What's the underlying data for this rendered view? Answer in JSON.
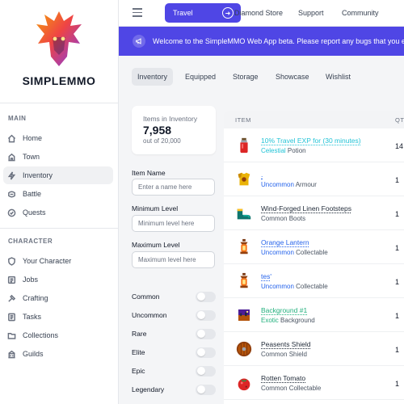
{
  "brand": {
    "name": "SIMPLEMMO"
  },
  "sidebar": {
    "main_section": "MAIN",
    "character_section": "CHARACTER",
    "main_items": [
      {
        "label": "Home",
        "icon": "home-icon"
      },
      {
        "label": "Town",
        "icon": "town-icon"
      },
      {
        "label": "Inventory",
        "icon": "lightning-icon",
        "active": true
      },
      {
        "label": "Battle",
        "icon": "battle-icon"
      },
      {
        "label": "Quests",
        "icon": "quest-icon"
      }
    ],
    "character_items": [
      {
        "label": "Your Character",
        "icon": "shield-icon"
      },
      {
        "label": "Jobs",
        "icon": "jobs-icon"
      },
      {
        "label": "Crafting",
        "icon": "crafting-icon"
      },
      {
        "label": "Tasks",
        "icon": "tasks-icon"
      },
      {
        "label": "Collections",
        "icon": "folder-icon"
      },
      {
        "label": "Guilds",
        "icon": "guilds-icon"
      }
    ]
  },
  "topbar": {
    "travel_label": "Travel",
    "links": [
      "Diamond Store",
      "Support",
      "Community"
    ]
  },
  "banner": {
    "text": "Welcome to the SimpleMMO Web App beta. Please report any bugs that you exp"
  },
  "tabs": [
    "Inventory",
    "Equipped",
    "Storage",
    "Showcase",
    "Wishlist"
  ],
  "stats": {
    "label": "Items in Inventory",
    "value": "7,958",
    "sub": "out of 20,000"
  },
  "filters": {
    "item_name_label": "Item Name",
    "item_name_placeholder": "Enter a name here",
    "min_level_label": "Minimum Level",
    "min_level_placeholder": "Minimum level here",
    "max_level_label": "Maximum Level",
    "max_level_placeholder": "Maximum level here",
    "rarities": [
      "Common",
      "Uncommon",
      "Rare",
      "Elite",
      "Epic",
      "Legendary"
    ]
  },
  "table": {
    "col_item": "ITEM",
    "col_qty": "QT",
    "rows": [
      {
        "name": "10% Travel EXP for (30 minutes)",
        "rarity": "Celestial",
        "type": "Potion",
        "qty": "14",
        "color_class": "c-celestial",
        "icon": "potion-icon"
      },
      {
        "name": ".",
        "rarity": "Uncommon",
        "type": "Armour",
        "qty": "1",
        "color_class": "c-uncommon",
        "icon": "armour-icon"
      },
      {
        "name": "Wind-Forged Linen Footsteps",
        "rarity": "Common",
        "type": "Boots",
        "qty": "1",
        "color_class": "c-common",
        "icon": "boots-icon"
      },
      {
        "name": "Orange Lantern",
        "rarity": "Uncommon",
        "type": "Collectable",
        "qty": "1",
        "color_class": "c-uncommon",
        "icon": "lantern-icon"
      },
      {
        "name": "tes'",
        "rarity": "Uncommon",
        "type": "Collectable",
        "qty": "1",
        "color_class": "c-uncommon",
        "icon": "lantern-icon"
      },
      {
        "name": "Background #1",
        "rarity": "Exotic",
        "type": "Background",
        "qty": "1",
        "color_class": "c-exotic",
        "icon": "background-icon"
      },
      {
        "name": "Peasents Shield",
        "rarity": "Common",
        "type": "Shield",
        "qty": "1",
        "color_class": "c-common",
        "icon": "shield-item-icon"
      },
      {
        "name": "Rotten Tomato",
        "rarity": "Common",
        "type": "Collectable",
        "qty": "1",
        "color_class": "c-common",
        "icon": "tomato-icon"
      }
    ]
  },
  "colors": {
    "accent": "#4f46e5",
    "celestial": "#22c3d6",
    "uncommon": "#2563eb",
    "exotic": "#22b07d"
  }
}
